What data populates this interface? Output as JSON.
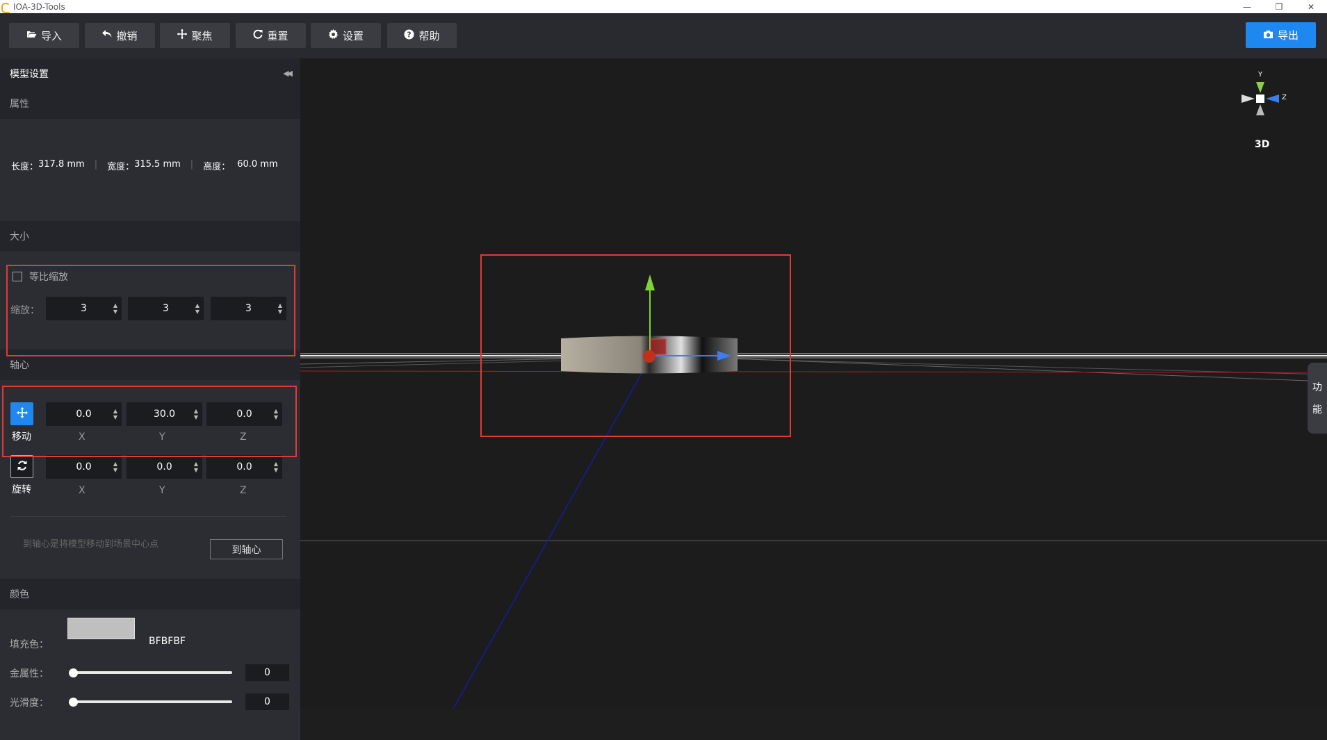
{
  "window": {
    "title": "IOA-3D-Tools",
    "controls": {
      "minimize": "—",
      "restore": "❐",
      "close": "✕"
    }
  },
  "toolbar": {
    "import": "导入",
    "undo": "撤销",
    "focus": "聚焦",
    "reset": "重置",
    "settings": "设置",
    "help": "帮助",
    "export": "导出"
  },
  "panel": {
    "title": "模型设置",
    "collapse_icon": "◀◀",
    "properties": {
      "title": "属性",
      "length_label": "长度：",
      "length_value": "317.8 mm",
      "width_label": "宽度：",
      "width_value": "315.5 mm",
      "height_label": "高度：",
      "height_value": "60.0 mm"
    },
    "size": {
      "title": "大小",
      "uniform_scale_label": "等比缩放",
      "uniform_scale_checked": false,
      "scale_label": "缩放：",
      "scale_x": "3",
      "scale_y": "3",
      "scale_z": "3"
    },
    "pivot": {
      "title": "轴心",
      "move_label": "移动",
      "move_x": "0.0",
      "move_y": "30.0",
      "move_z": "0.0",
      "rotate_label": "旋转",
      "rotate_x": "0.0",
      "rotate_y": "0.0",
      "rotate_z": "0.0",
      "axis_x": "X",
      "axis_y": "Y",
      "axis_z": "Z",
      "hint": "到轴心是将模型移动到场景中心点",
      "to_center_button": "到轴心"
    },
    "color": {
      "title": "颜色",
      "fill_label": "填充色：",
      "fill_hex": "BFBFBF",
      "fill_color": "#bfbfbf",
      "metalness_label": "金属性：",
      "metalness_value": "0",
      "smoothness_label": "光滑度：",
      "smoothness_value": "0"
    }
  },
  "viewport": {
    "gizmo_label": "3D",
    "gizmo_y": "Y",
    "gizmo_z": "Z",
    "side_tab_1": "功",
    "side_tab_2": "能"
  },
  "colors": {
    "accent": "#1e88f0",
    "highlight": "#e23a36",
    "panel_bg": "#2b2d33",
    "section_bg": "#23252a"
  }
}
